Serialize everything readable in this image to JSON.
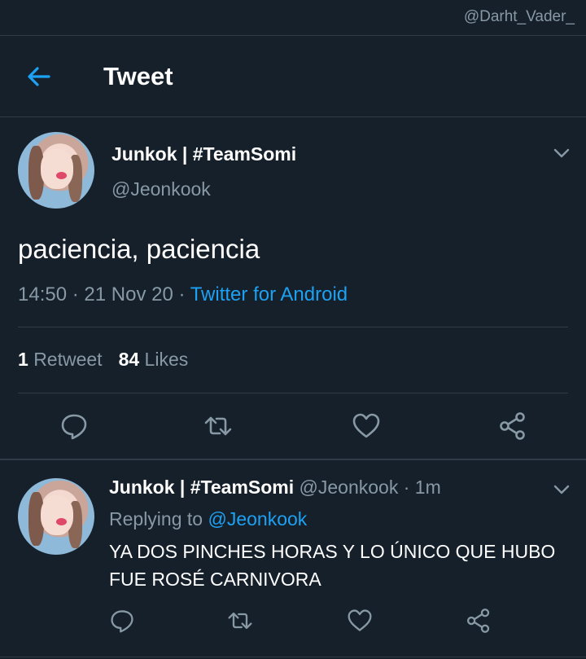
{
  "watermark": "@Darht_Vader_",
  "header": {
    "title": "Tweet"
  },
  "tweet": {
    "display_name": "Junkok | #TeamSomi",
    "handle": "@Jeonkook",
    "text": "paciencia, paciencia",
    "time": "14:50",
    "date": "21 Nov 20",
    "separator": "·",
    "source": "Twitter for Android",
    "retweet_count": "1",
    "retweet_label": "Retweet",
    "like_count": "84",
    "like_label": "Likes"
  },
  "reply": {
    "display_name": "Junkok | #TeamSomi",
    "handle": "@Jeonkook",
    "time_ago": "· 1m",
    "replying_to_label": "Replying to",
    "replying_to_handle": "@Jeonkook",
    "text": "YA DOS PINCHES HORAS Y LO ÚNICO QUE HUBO FUE ROSÉ CARNIVORA"
  },
  "colors": {
    "background": "#15202b",
    "accent": "#1da1f2",
    "secondary_text": "#8899a6",
    "divider": "#2f3b47"
  },
  "icons": {
    "back": "arrow-left-icon",
    "more": "chevron-down-icon",
    "reply": "comment-icon",
    "retweet": "retweet-icon",
    "like": "heart-icon",
    "share": "share-icon"
  }
}
